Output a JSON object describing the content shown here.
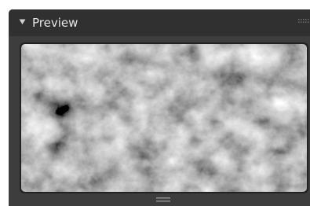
{
  "panel": {
    "title": "Preview",
    "collapse_icon": "triangle-down-icon",
    "grip_icon": "drag-grip-icon",
    "resize_icon": "resize-handle-icon",
    "colors": {
      "panel_bg": "#3d3d3d",
      "header_bg": "#303030",
      "title_text": "#e6e6e6",
      "preview_border": "#222222"
    }
  },
  "preview": {
    "content": "grayscale-cloud-noise-texture"
  }
}
